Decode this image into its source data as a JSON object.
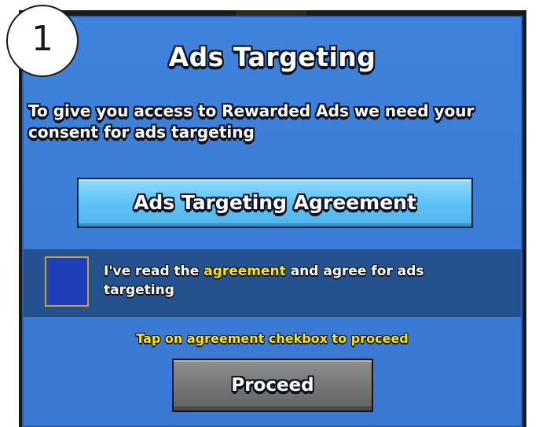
{
  "dialog": {
    "step_number": "1",
    "title": "Ads Targeting",
    "message": "To give you access to Rewarded Ads we need your consent for ads targeting",
    "agreement_button_label": "Ads Targeting Agreement",
    "consent": {
      "text_before": "I've read the ",
      "link_text": "agreement",
      "text_after": " and agree for ads targeting",
      "checked": false
    },
    "hint": "Tap on agreement chekbox to proceed",
    "proceed_button_label": "Proceed"
  },
  "colors": {
    "dialog_blue": "#3a7bd5",
    "band_blue": "#23528f",
    "checkbox_fill": "#1f3fb8",
    "accent_yellow": "#ffe600",
    "agreement_button": "#63c5f5",
    "proceed_button": "#777777"
  }
}
